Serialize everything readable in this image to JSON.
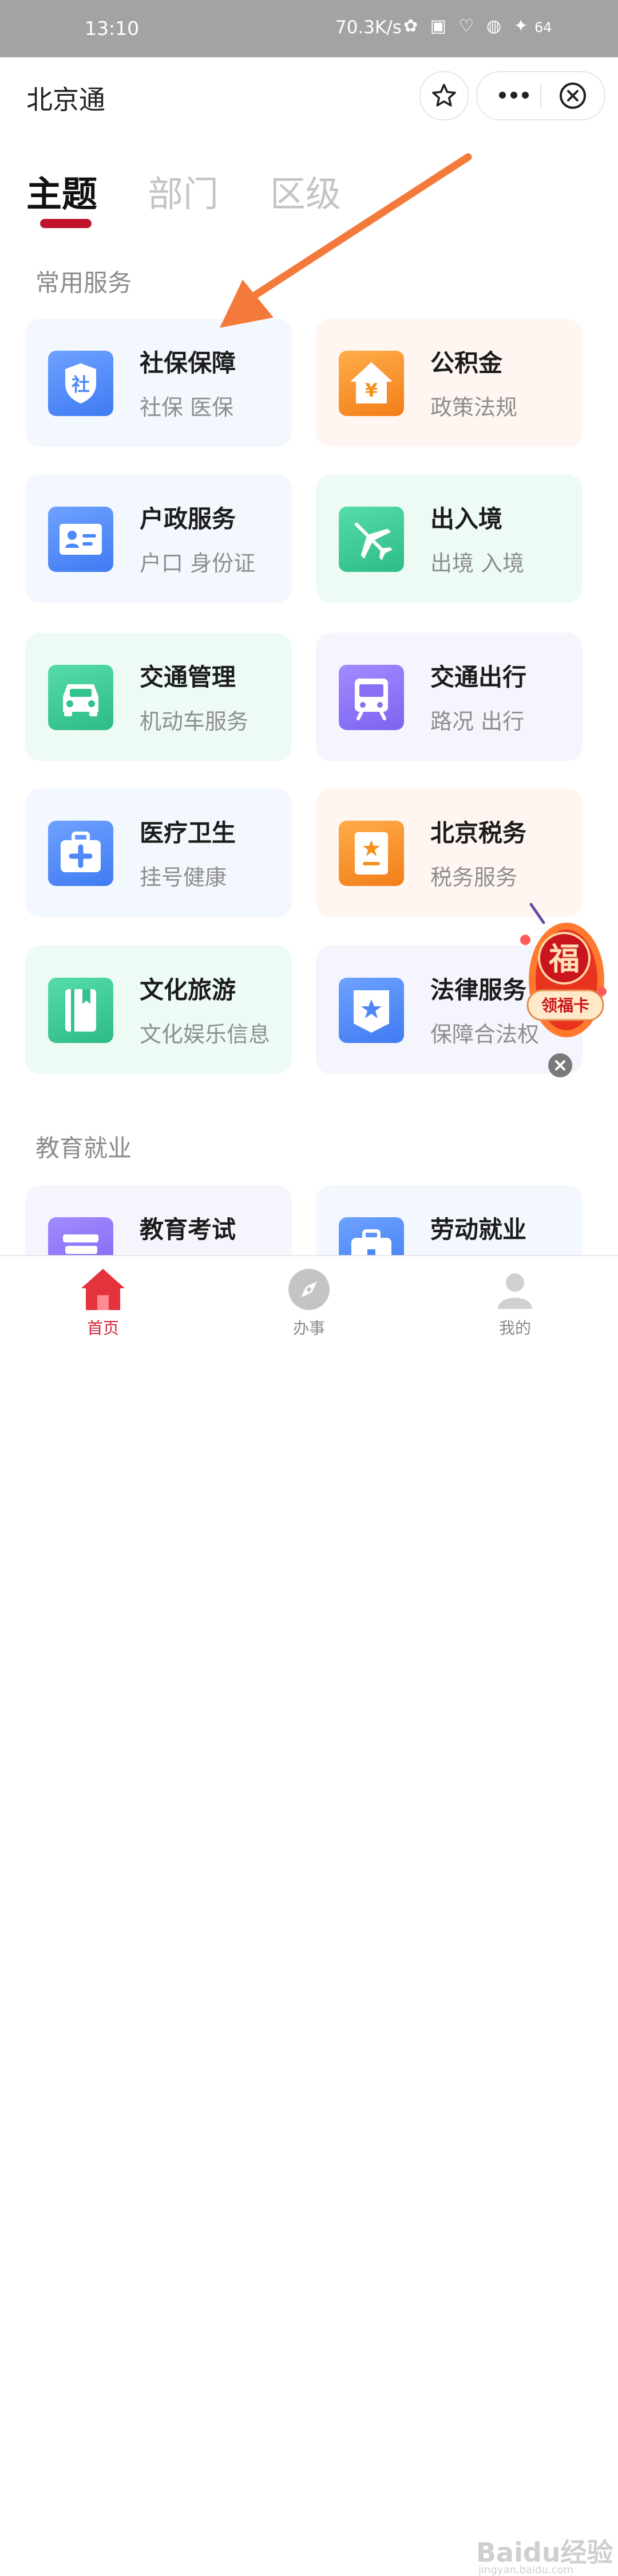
{
  "status_bar": {
    "time": "13:10",
    "net_speed": "70.3K/s",
    "battery": "64"
  },
  "app_bar": {
    "title": "北京通"
  },
  "tabs": [
    {
      "label": "主题",
      "active": true
    },
    {
      "label": "部门",
      "active": false
    },
    {
      "label": "区级",
      "active": false
    }
  ],
  "sections": {
    "common": "常用服务",
    "education": "教育就业"
  },
  "services": [
    {
      "title": "社保保障",
      "subtitle": "社保 医保",
      "icon": "shield-icon",
      "icon_glyph": "社",
      "color": "#4d88f6"
    },
    {
      "title": "公积金",
      "subtitle": "政策法规",
      "icon": "house-yen-icon",
      "icon_glyph": "¥",
      "color": "#f5901f"
    },
    {
      "title": "户政服务",
      "subtitle": "户口 身份证",
      "icon": "id-card-icon",
      "color": "#4d88f6"
    },
    {
      "title": "出入境",
      "subtitle": "出境 入境",
      "icon": "airplane-icon",
      "color": "#33c38e"
    },
    {
      "title": "交通管理",
      "subtitle": "机动车服务",
      "icon": "car-icon",
      "color": "#33c38e"
    },
    {
      "title": "交通出行",
      "subtitle": "路况 出行",
      "icon": "bus-icon",
      "color": "#8a70f4"
    },
    {
      "title": "医疗卫生",
      "subtitle": "挂号健康",
      "icon": "medical-kit-icon",
      "color": "#4d88f6"
    },
    {
      "title": "北京税务",
      "subtitle": "税务服务",
      "icon": "tax-document-icon",
      "color": "#f5901f"
    },
    {
      "title": "文化旅游",
      "subtitle": "文化娱乐信息",
      "icon": "book-icon",
      "color": "#33c38e"
    },
    {
      "title": "法律服务",
      "subtitle": "保障合法权",
      "icon": "law-badge-icon",
      "color": "#4d88f6"
    },
    {
      "title": "教育考试",
      "icon": "books-icon",
      "color": "#8a70f4"
    },
    {
      "title": "劳动就业",
      "icon": "briefcase-icon",
      "color": "#4d88f6"
    }
  ],
  "promo": {
    "glyph": "福",
    "label": "领福卡"
  },
  "bottom_nav": [
    {
      "label": "首页",
      "icon": "home-icon",
      "active": true
    },
    {
      "label": "办事",
      "icon": "compass-icon",
      "active": false
    },
    {
      "label": "我的",
      "icon": "user-icon",
      "active": false
    }
  ],
  "watermark": {
    "text": "Baidu经验",
    "sub": "jingyan.baidu.com"
  },
  "colors": {
    "accent": "#c0142c",
    "annotation_arrow": "#f47a3c",
    "status_bar": "#a3a3a3"
  }
}
